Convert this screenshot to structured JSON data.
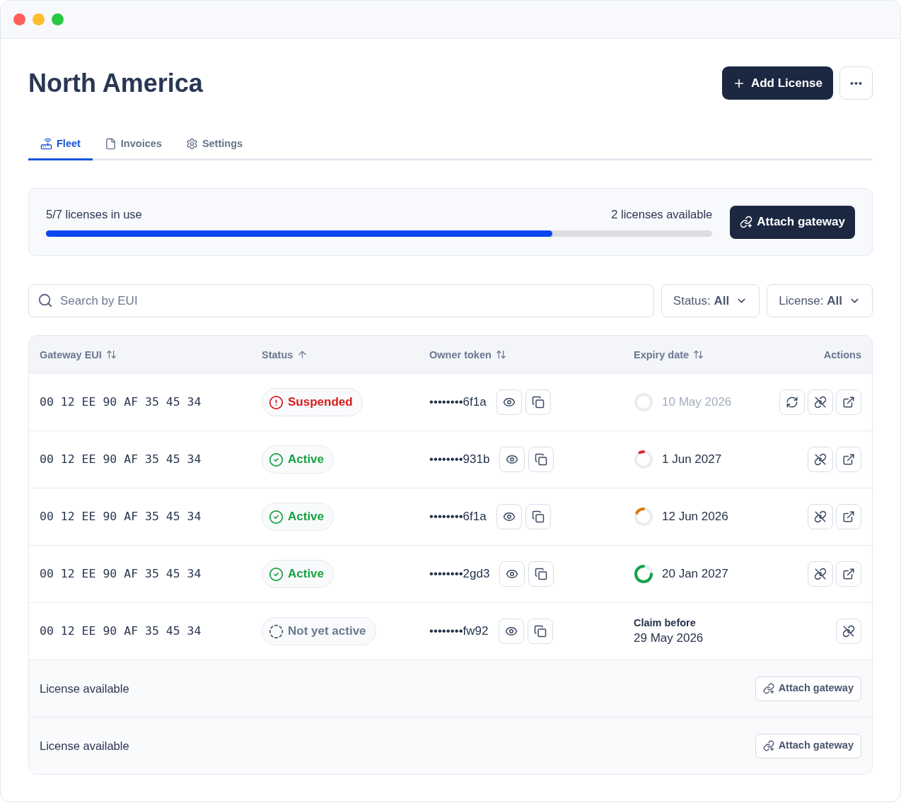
{
  "page": {
    "title": "North America",
    "primary_action": "Add License"
  },
  "tabs": [
    {
      "kind": "fleet",
      "label": "Fleet",
      "selected": true
    },
    {
      "kind": "invoices",
      "label": "Invoices",
      "selected": false
    },
    {
      "kind": "settings",
      "label": "Settings",
      "selected": false
    }
  ],
  "usage": {
    "in_use": "5/7 licenses in use",
    "available": "2 licenses available",
    "level": 0.76,
    "action": "Attach gateway"
  },
  "filters": {
    "search": {
      "placeholder": "Search by EUI"
    },
    "dropdowns": [
      {
        "label": "Status: **All**"
      },
      {
        "label": "License: **All**"
      }
    ]
  },
  "table": {
    "columns": [
      {
        "label": "Gateway EUI",
        "sortable": true,
        "sorted": false
      },
      {
        "label": "Status",
        "sortable": true,
        "sorted": true
      },
      {
        "label": "Owner token",
        "sortable": true,
        "sorted": false
      },
      {
        "label": "Expiry date",
        "sortable": true,
        "sorted": false
      },
      {
        "label": "Actions",
        "sortable": false
      }
    ],
    "rows": [
      {
        "eui": "00 12 EE 90 AF 35 45 34",
        "status": {
          "kind": "suspended",
          "label": "Suspended"
        },
        "token": "••••••••6f1a",
        "expiry": {
          "kind": "empty",
          "date": "10 May 2026",
          "muted": true
        },
        "actions": [
          {
            "kind": "renew"
          },
          {
            "kind": "detach"
          },
          {
            "kind": "open"
          }
        ]
      },
      {
        "eui": "00 12 EE 90 AF 35 45 34",
        "status": {
          "kind": "active",
          "label": "Active"
        },
        "token": "••••••••931b",
        "expiry": {
          "kind": "low",
          "date": "1 Jun 2027",
          "muted": false
        },
        "actions": [
          {
            "kind": "detach"
          },
          {
            "kind": "open"
          }
        ]
      },
      {
        "eui": "00 12 EE 90 AF 35 45 34",
        "status": {
          "kind": "active",
          "label": "Active"
        },
        "token": "••••••••6f1a",
        "expiry": {
          "kind": "medium",
          "date": "12 Jun 2026",
          "muted": false
        },
        "actions": [
          {
            "kind": "detach"
          },
          {
            "kind": "open"
          }
        ]
      },
      {
        "eui": "00 12 EE 90 AF 35 45 34",
        "status": {
          "kind": "active",
          "label": "Active"
        },
        "token": "••••••••2gd3",
        "expiry": {
          "kind": "high",
          "date": "20 Jan 2027",
          "muted": false
        },
        "actions": [
          {
            "kind": "detach"
          },
          {
            "kind": "open"
          }
        ]
      },
      {
        "eui": "00 12 EE 90 AF 35 45 34",
        "status": {
          "kind": "pending",
          "label": "Not yet active"
        },
        "token": "••••••••fw92",
        "expiry": {
          "kind": "claim",
          "note": "Claim before",
          "date": "29 May 2026"
        },
        "actions": [
          {
            "kind": "detach"
          }
        ]
      }
    ],
    "open_slots": [
      {
        "label": "License available",
        "action": "Attach gateway"
      },
      {
        "label": "License available",
        "action": "Attach gateway"
      }
    ]
  }
}
